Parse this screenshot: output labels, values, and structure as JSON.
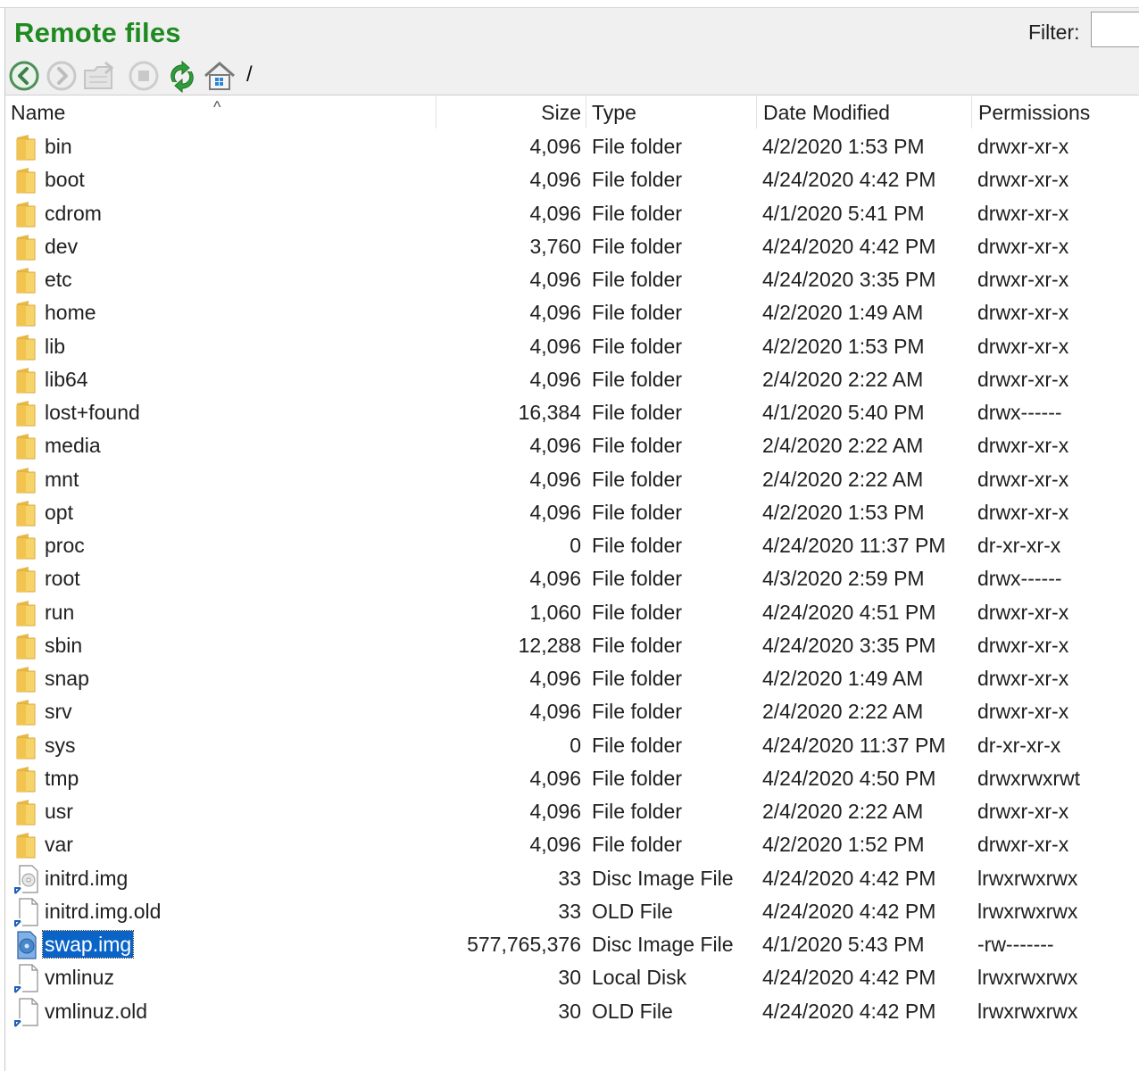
{
  "panel": {
    "title": "Remote files",
    "filter_label": "Filter:",
    "filter_value": "",
    "accent": "#1f8a1f",
    "selection_color": "#0a64c8"
  },
  "toolbar": {
    "buttons": [
      "back-icon",
      "forward-icon",
      "folder-up-icon",
      "stop-icon",
      "refresh-icon",
      "home-icon"
    ],
    "path": "/"
  },
  "columns": {
    "name": "Name",
    "size": "Size",
    "type": "Type",
    "date": "Date Modified",
    "permissions": "Permissions",
    "sort_indicator": "^"
  },
  "files": [
    {
      "name": "bin",
      "size": "4,096",
      "type": "File folder",
      "date": "4/2/2020 1:53 PM",
      "perm": "drwxr-xr-x",
      "icon": "folder-icon"
    },
    {
      "name": "boot",
      "size": "4,096",
      "type": "File folder",
      "date": "4/24/2020 4:42 PM",
      "perm": "drwxr-xr-x",
      "icon": "folder-icon"
    },
    {
      "name": "cdrom",
      "size": "4,096",
      "type": "File folder",
      "date": "4/1/2020 5:41 PM",
      "perm": "drwxr-xr-x",
      "icon": "folder-icon"
    },
    {
      "name": "dev",
      "size": "3,760",
      "type": "File folder",
      "date": "4/24/2020 4:42 PM",
      "perm": "drwxr-xr-x",
      "icon": "folder-icon"
    },
    {
      "name": "etc",
      "size": "4,096",
      "type": "File folder",
      "date": "4/24/2020 3:35 PM",
      "perm": "drwxr-xr-x",
      "icon": "folder-icon"
    },
    {
      "name": "home",
      "size": "4,096",
      "type": "File folder",
      "date": "4/2/2020 1:49 AM",
      "perm": "drwxr-xr-x",
      "icon": "folder-icon"
    },
    {
      "name": "lib",
      "size": "4,096",
      "type": "File folder",
      "date": "4/2/2020 1:53 PM",
      "perm": "drwxr-xr-x",
      "icon": "folder-icon"
    },
    {
      "name": "lib64",
      "size": "4,096",
      "type": "File folder",
      "date": "2/4/2020 2:22 AM",
      "perm": "drwxr-xr-x",
      "icon": "folder-icon"
    },
    {
      "name": "lost+found",
      "size": "16,384",
      "type": "File folder",
      "date": "4/1/2020 5:40 PM",
      "perm": "drwx------",
      "icon": "folder-icon"
    },
    {
      "name": "media",
      "size": "4,096",
      "type": "File folder",
      "date": "2/4/2020 2:22 AM",
      "perm": "drwxr-xr-x",
      "icon": "folder-icon"
    },
    {
      "name": "mnt",
      "size": "4,096",
      "type": "File folder",
      "date": "2/4/2020 2:22 AM",
      "perm": "drwxr-xr-x",
      "icon": "folder-icon"
    },
    {
      "name": "opt",
      "size": "4,096",
      "type": "File folder",
      "date": "4/2/2020 1:53 PM",
      "perm": "drwxr-xr-x",
      "icon": "folder-icon"
    },
    {
      "name": "proc",
      "size": "0",
      "type": "File folder",
      "date": "4/24/2020 11:37 PM",
      "perm": "dr-xr-xr-x",
      "icon": "folder-icon"
    },
    {
      "name": "root",
      "size": "4,096",
      "type": "File folder",
      "date": "4/3/2020 2:59 PM",
      "perm": "drwx------",
      "icon": "folder-icon"
    },
    {
      "name": "run",
      "size": "1,060",
      "type": "File folder",
      "date": "4/24/2020 4:51 PM",
      "perm": "drwxr-xr-x",
      "icon": "folder-icon"
    },
    {
      "name": "sbin",
      "size": "12,288",
      "type": "File folder",
      "date": "4/24/2020 3:35 PM",
      "perm": "drwxr-xr-x",
      "icon": "folder-icon"
    },
    {
      "name": "snap",
      "size": "4,096",
      "type": "File folder",
      "date": "4/2/2020 1:49 AM",
      "perm": "drwxr-xr-x",
      "icon": "folder-icon"
    },
    {
      "name": "srv",
      "size": "4,096",
      "type": "File folder",
      "date": "2/4/2020 2:22 AM",
      "perm": "drwxr-xr-x",
      "icon": "folder-icon"
    },
    {
      "name": "sys",
      "size": "0",
      "type": "File folder",
      "date": "4/24/2020 11:37 PM",
      "perm": "dr-xr-xr-x",
      "icon": "folder-icon"
    },
    {
      "name": "tmp",
      "size": "4,096",
      "type": "File folder",
      "date": "4/24/2020 4:50 PM",
      "perm": "drwxrwxrwt",
      "icon": "folder-icon"
    },
    {
      "name": "usr",
      "size": "4,096",
      "type": "File folder",
      "date": "2/4/2020 2:22 AM",
      "perm": "drwxr-xr-x",
      "icon": "folder-icon"
    },
    {
      "name": "var",
      "size": "4,096",
      "type": "File folder",
      "date": "4/2/2020 1:52 PM",
      "perm": "drwxr-xr-x",
      "icon": "folder-icon"
    },
    {
      "name": "initrd.img",
      "size": "33",
      "type": "Disc Image File",
      "date": "4/24/2020 4:42 PM",
      "perm": "lrwxrwxrwx",
      "icon": "disc-image-shortcut-icon"
    },
    {
      "name": "initrd.img.old",
      "size": "33",
      "type": "OLD File",
      "date": "4/24/2020 4:42 PM",
      "perm": "lrwxrwxrwx",
      "icon": "file-shortcut-icon"
    },
    {
      "name": "swap.img",
      "size": "577,765,376",
      "type": "Disc Image File",
      "date": "4/1/2020 5:43 PM",
      "perm": "-rw-------",
      "icon": "disc-image-icon",
      "selected": true
    },
    {
      "name": "vmlinuz",
      "size": "30",
      "type": "Local Disk",
      "date": "4/24/2020 4:42 PM",
      "perm": "lrwxrwxrwx",
      "icon": "file-shortcut-icon"
    },
    {
      "name": "vmlinuz.old",
      "size": "30",
      "type": "OLD File",
      "date": "4/24/2020 4:42 PM",
      "perm": "lrwxrwxrwx",
      "icon": "file-shortcut-icon"
    }
  ]
}
